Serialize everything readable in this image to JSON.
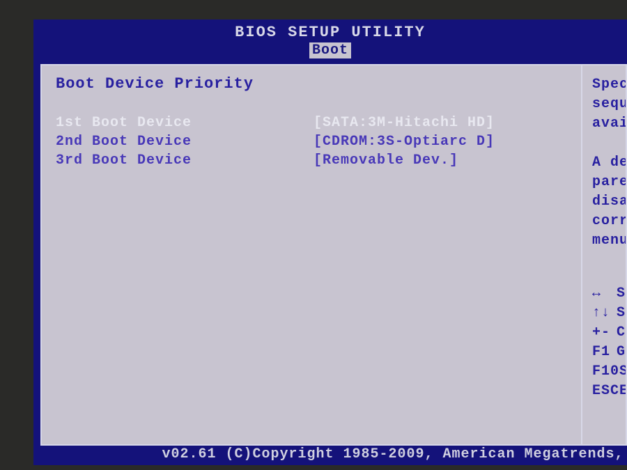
{
  "title": "BIOS SETUP UTILITY",
  "active_tab": "Boot",
  "section_title": "Boot Device Priority",
  "boot_devices": [
    {
      "label": "1st Boot Device",
      "value": "[SATA:3M-Hitachi HD]",
      "selected": true
    },
    {
      "label": "2nd Boot Device",
      "value": "[CDROM:3S-Optiarc D]",
      "selected": false
    },
    {
      "label": "3rd Boot Device",
      "value": "[Removable Dev.]",
      "selected": false
    }
  ],
  "help": {
    "line1": "Speci",
    "line2": "seque",
    "line3": "avail",
    "line4": "A dev",
    "line5": "parent",
    "line6": "disabl",
    "line7": "corres",
    "line8": "menu."
  },
  "keys": [
    {
      "sym": "↔",
      "desc": "S"
    },
    {
      "sym": "↑↓",
      "desc": "S"
    },
    {
      "sym": "+-",
      "desc": "C"
    },
    {
      "sym": "F1",
      "desc": "G"
    },
    {
      "sym": "F10",
      "desc": "Sa"
    },
    {
      "sym": "ESC",
      "desc": "Ex"
    }
  ],
  "footer": "v02.61 (C)Copyright 1985-2009, American Megatrends,"
}
